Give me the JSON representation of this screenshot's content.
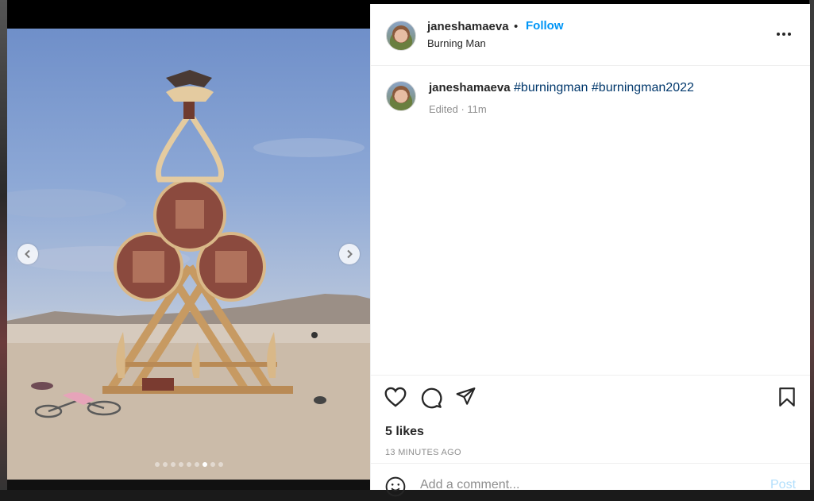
{
  "post": {
    "username": "janeshamaeva",
    "separator": "•",
    "follow_label": "Follow",
    "location": "Burning Man",
    "caption_username": "janeshamaeva",
    "hashtags": [
      "#burningman",
      "#burningman2022"
    ],
    "edited_label": "Edited · 11m",
    "likes": "5 likes",
    "timestamp": "13 MINUTES AGO"
  },
  "comment": {
    "placeholder": "Add a comment...",
    "post_label": "Post"
  },
  "carousel": {
    "total_slides": 9,
    "active_index": 6
  },
  "icons": {
    "prev": "chevron-left-icon",
    "next": "chevron-right-icon",
    "like": "heart-icon",
    "comment": "comment-bubble-icon",
    "share": "paper-plane-icon",
    "save": "bookmark-icon",
    "emoji": "smiley-icon",
    "more": "more-options-icon"
  },
  "colors": {
    "accent": "#0095f6",
    "hashtag": "#00376b",
    "muted": "#8e8e8e",
    "post_disabled": "#b2dffc"
  }
}
